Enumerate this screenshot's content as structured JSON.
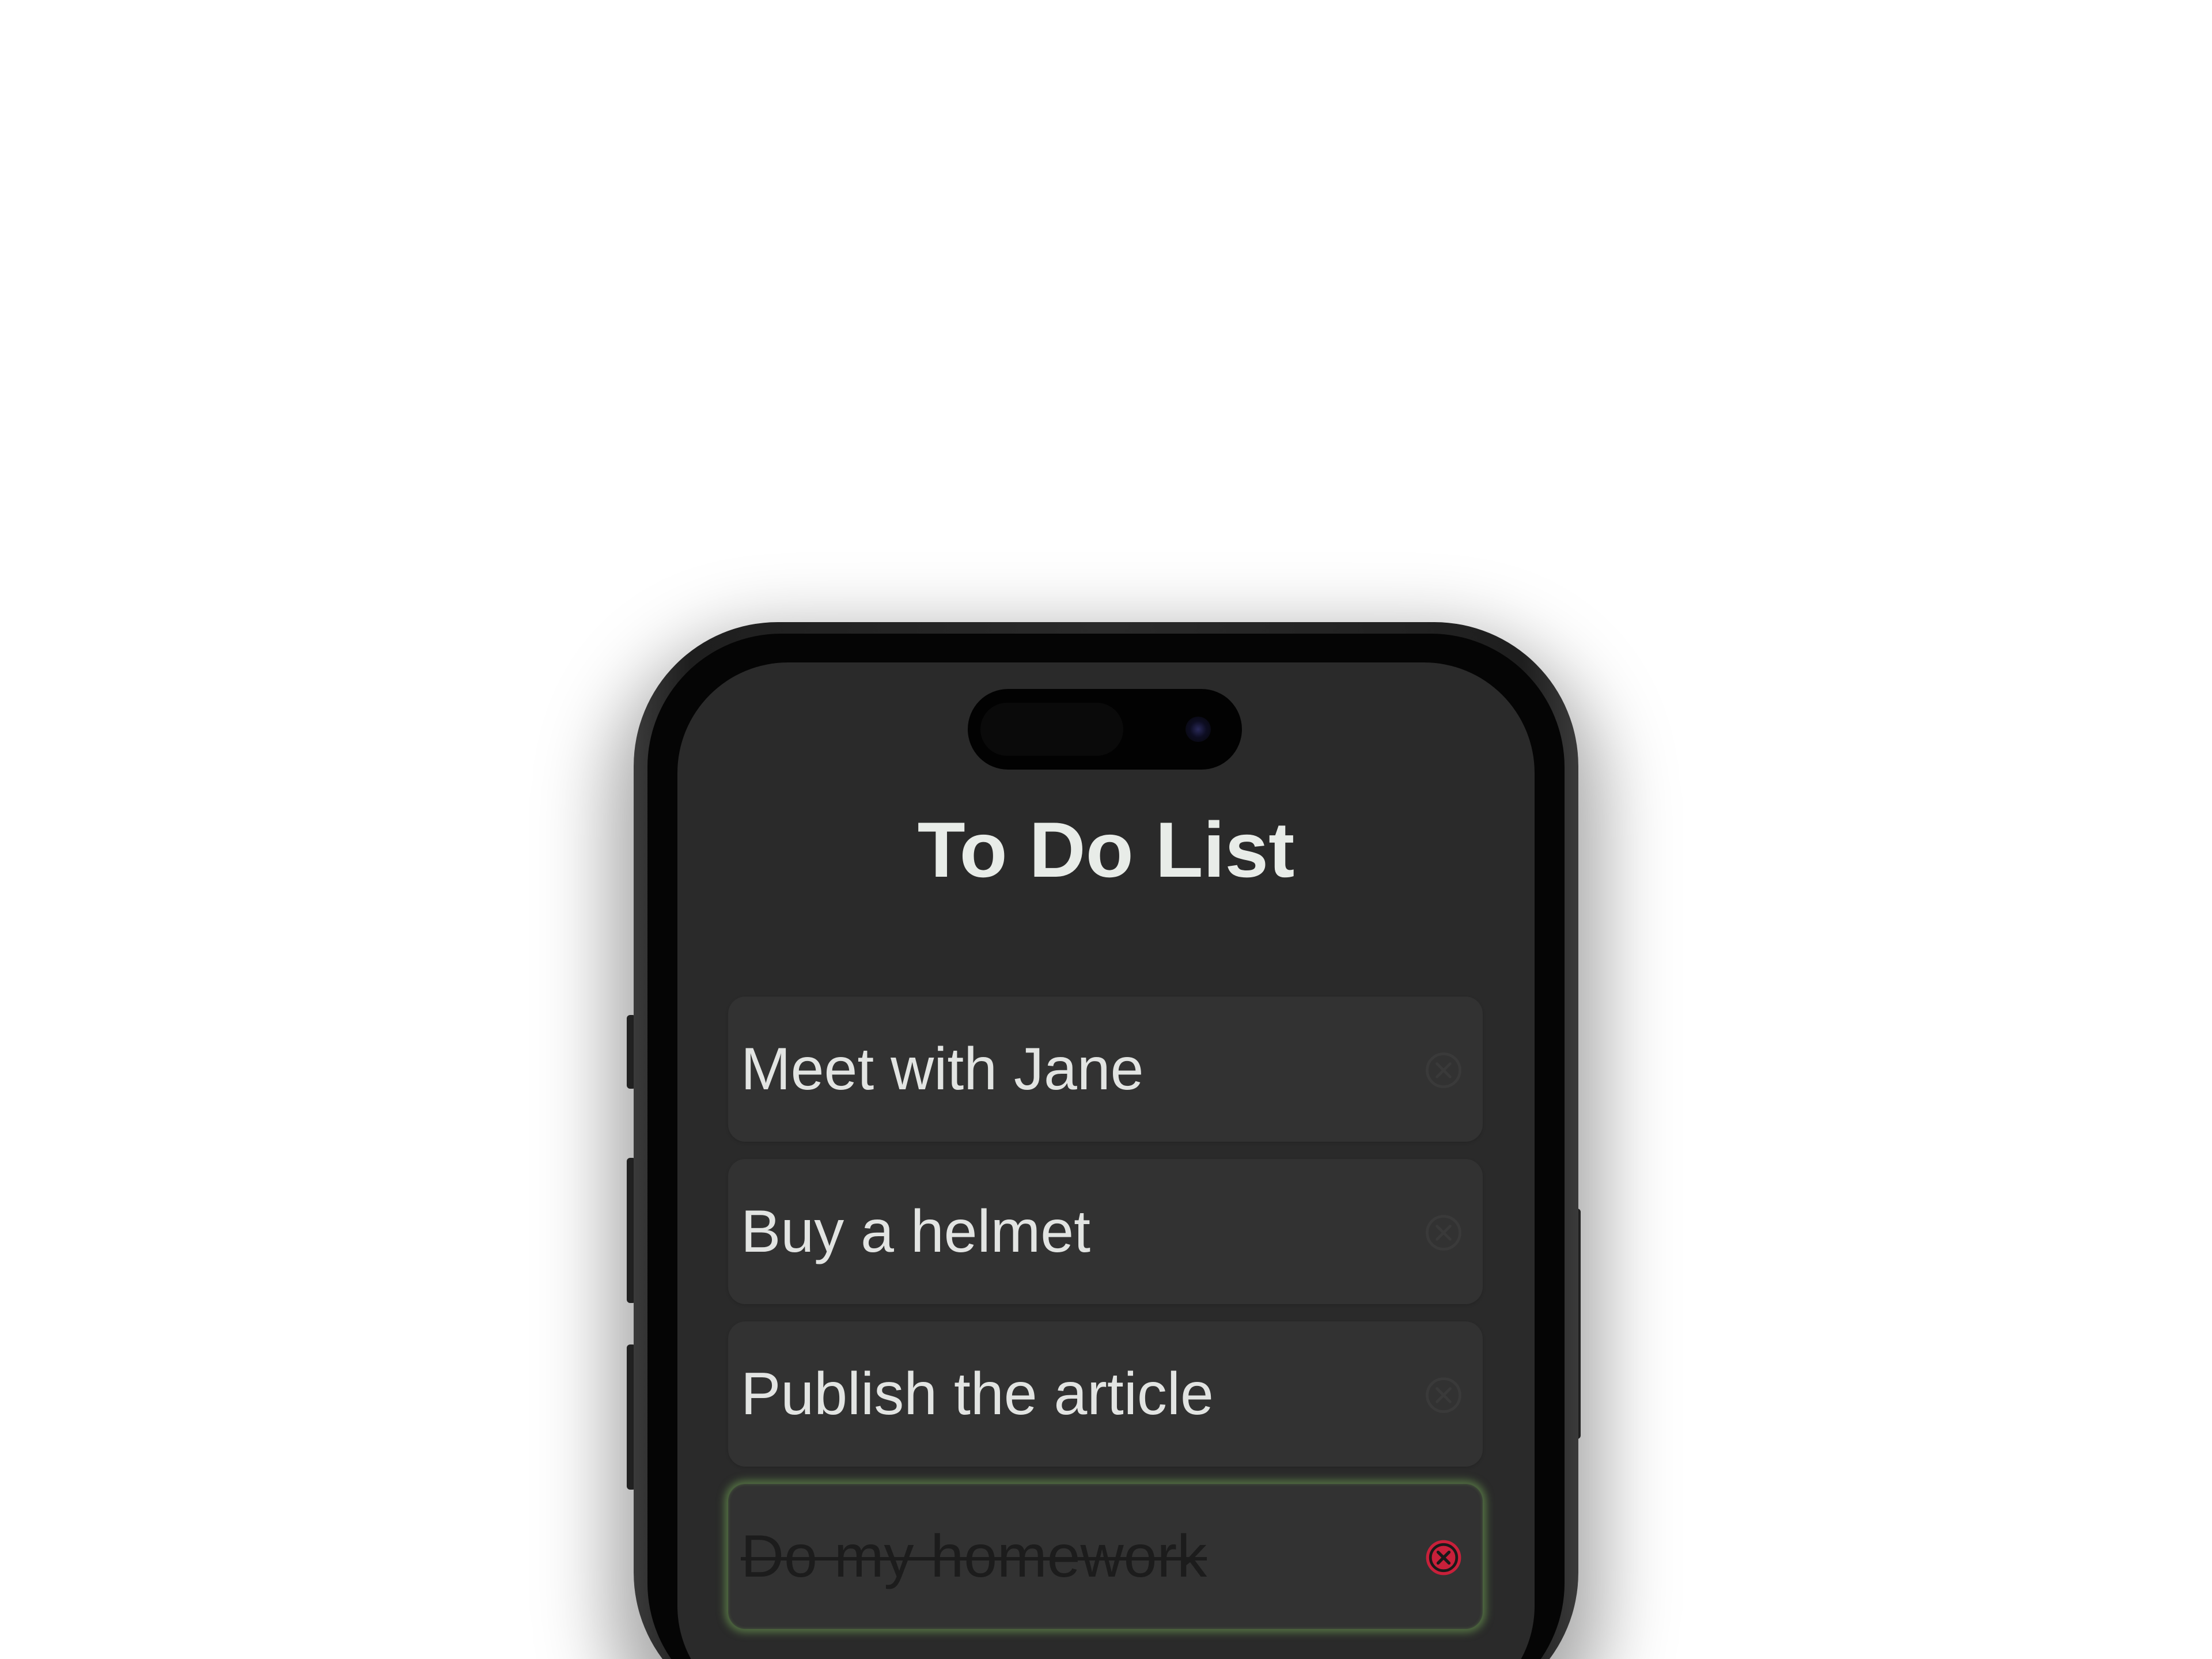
{
  "app": {
    "title": "To Do List"
  },
  "todos": [
    {
      "text": "Meet with Jane",
      "done": false
    },
    {
      "text": "Buy a helmet",
      "done": false
    },
    {
      "text": "Publish the article",
      "done": false
    },
    {
      "text": "Do my homework",
      "done": true
    }
  ],
  "icons": {
    "delete": "close-circle-icon"
  },
  "colors": {
    "screen_background": "#2a2a2a",
    "item_background": "#323232",
    "text": "#e2e4e2",
    "done_glow": "#78af5a",
    "delete_active": "#c8203a"
  }
}
